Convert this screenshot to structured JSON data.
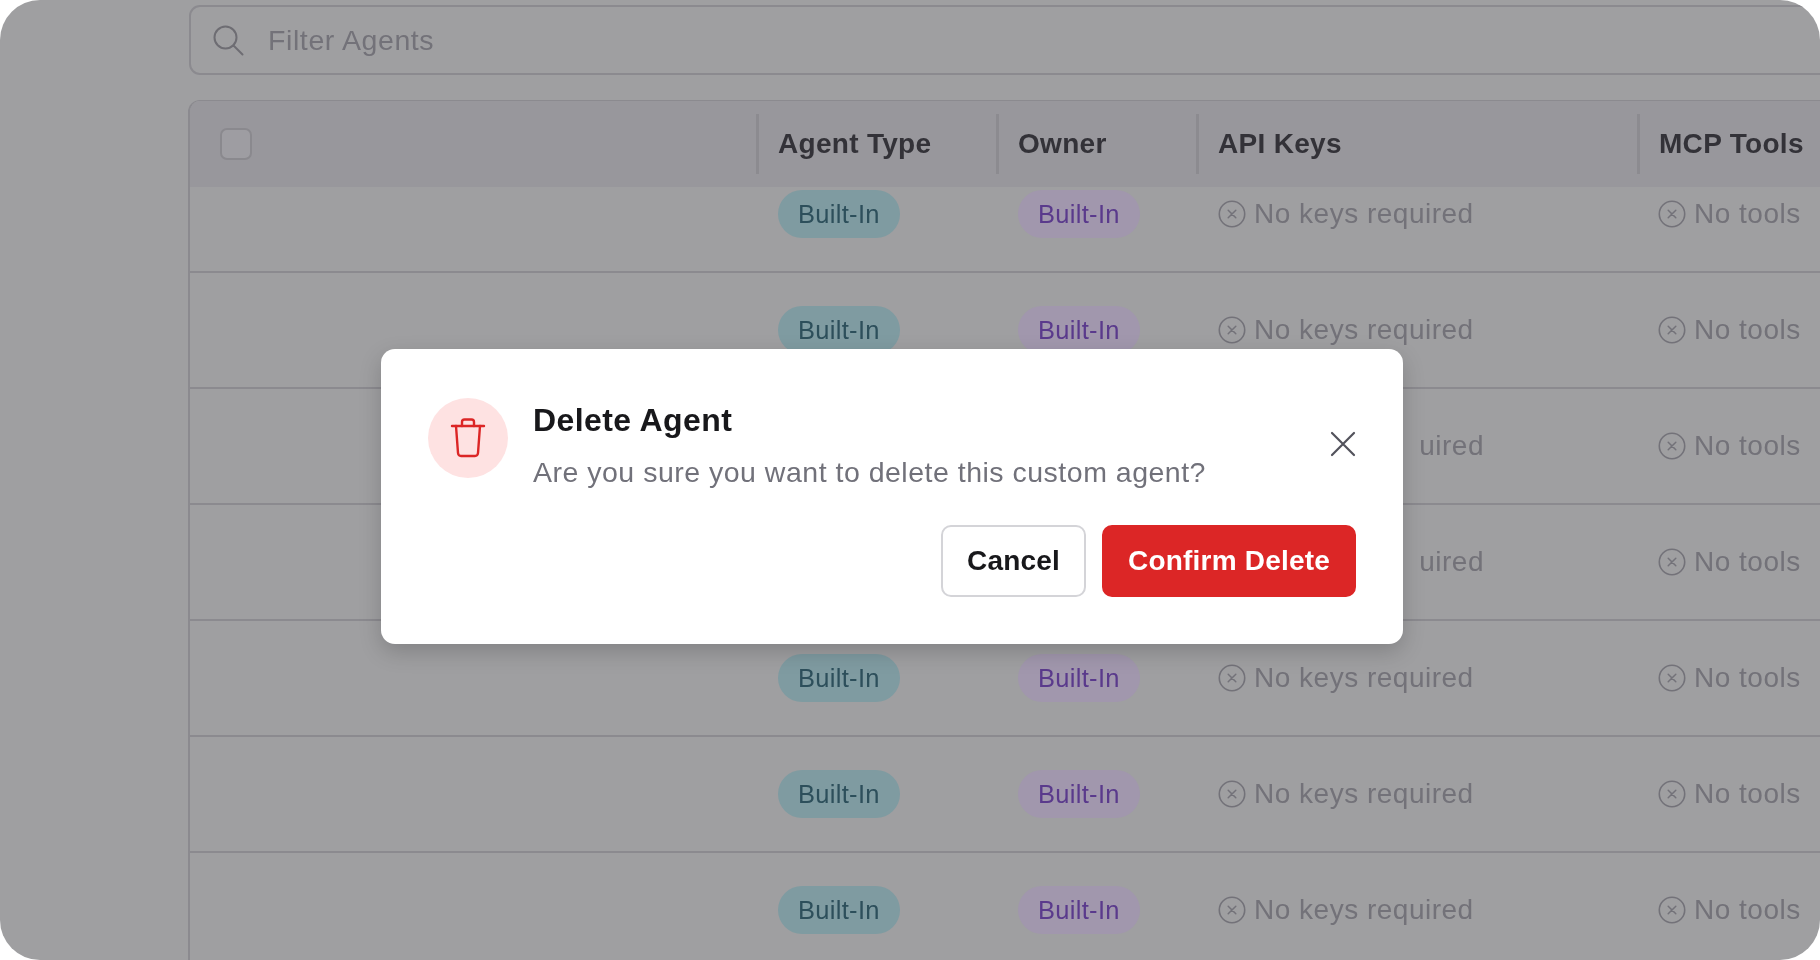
{
  "search": {
    "placeholder": "Filter Agents"
  },
  "table": {
    "select_all": {
      "checked": false
    },
    "columns": [
      "Agent Type",
      "Owner",
      "API Keys",
      "MCP Tools"
    ],
    "rows": [
      {
        "agent_type": "Built-In",
        "owner": "Built-In",
        "api_keys": {
          "kind": "status",
          "text": "No keys required"
        },
        "mcp_tools": {
          "kind": "status",
          "text": "No tools"
        }
      },
      {
        "agent_type": "Built-In",
        "owner": "Built-In",
        "api_keys": {
          "kind": "status",
          "text": "No keys required"
        },
        "mcp_tools": {
          "kind": "status",
          "text": "No tools"
        }
      },
      {
        "api_keys": {
          "kind": "fragment",
          "text": "uired"
        },
        "mcp_tools": {
          "kind": "status",
          "text": "No tools"
        }
      },
      {
        "api_keys": {
          "kind": "fragment",
          "text": "uired"
        },
        "mcp_tools": {
          "kind": "status",
          "text": "No tools"
        }
      },
      {
        "agent_type": "Built-In",
        "owner": "Built-In",
        "api_keys": {
          "kind": "status",
          "text": "No keys required"
        },
        "mcp_tools": {
          "kind": "status",
          "text": "No tools"
        }
      },
      {
        "agent_type": "Built-In",
        "owner": "Built-In",
        "api_keys": {
          "kind": "status",
          "text": "No keys required"
        },
        "mcp_tools": {
          "kind": "status",
          "text": "No tools"
        }
      },
      {
        "agent_type": "Built-In",
        "owner": "Built-In",
        "api_keys": {
          "kind": "status",
          "text": "No keys required"
        },
        "mcp_tools": {
          "kind": "status",
          "text": "No tools"
        }
      }
    ]
  },
  "dialog": {
    "title": "Delete Agent",
    "message": "Are you sure you want to delete this custom agent?",
    "buttons": [
      {
        "kind": "cancel",
        "label": "Cancel"
      },
      {
        "kind": "danger",
        "label": "Confirm Delete"
      }
    ]
  }
}
